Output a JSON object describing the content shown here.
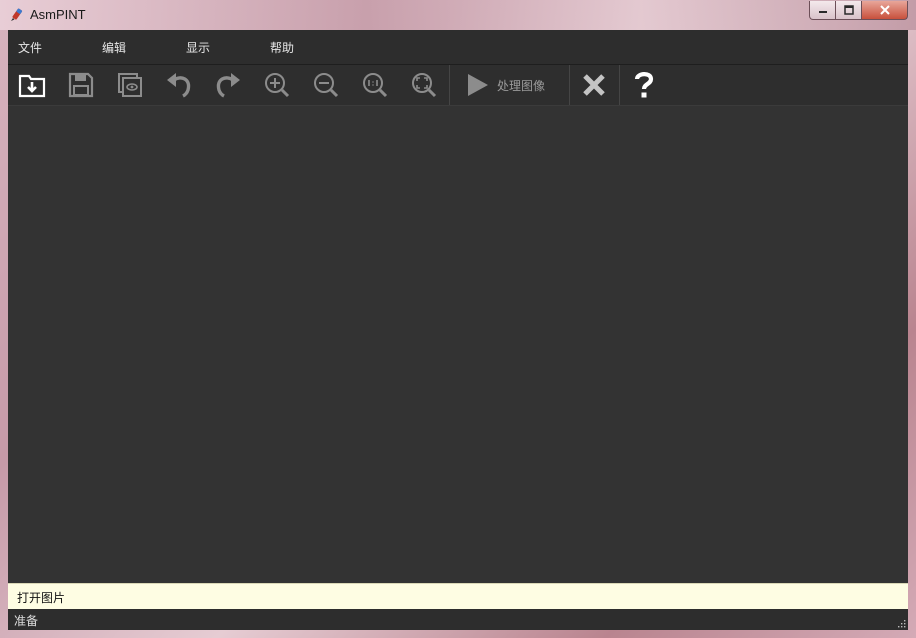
{
  "window": {
    "title": "AsmPINT"
  },
  "menubar": {
    "items": [
      {
        "label": "文件"
      },
      {
        "label": "编辑"
      },
      {
        "label": "显示"
      },
      {
        "label": "帮助"
      }
    ]
  },
  "toolbar": {
    "process_label": "处理图像",
    "buttons": [
      {
        "icon": "open-folder-icon",
        "enabled": true
      },
      {
        "icon": "save-icon",
        "enabled": false
      },
      {
        "icon": "preview-icon",
        "enabled": false
      },
      {
        "icon": "undo-icon",
        "enabled": false
      },
      {
        "icon": "redo-icon",
        "enabled": false
      },
      {
        "icon": "zoom-in-icon",
        "enabled": false
      },
      {
        "icon": "zoom-out-icon",
        "enabled": false
      },
      {
        "icon": "actual-size-icon",
        "enabled": false
      },
      {
        "icon": "fit-window-icon",
        "enabled": false
      },
      {
        "icon": "play-icon",
        "enabled": false
      },
      {
        "icon": "close-x-icon",
        "enabled": true
      },
      {
        "icon": "help-icon",
        "enabled": true
      }
    ]
  },
  "hint": {
    "text": "打开图片"
  },
  "status": {
    "text": "准备"
  },
  "colors": {
    "canvas": "#333333",
    "toolbar": "#2e2e2e",
    "hint_bg": "#fefde3",
    "icon_enabled": "#ffffff",
    "icon_disabled": "#8c8c8c"
  }
}
